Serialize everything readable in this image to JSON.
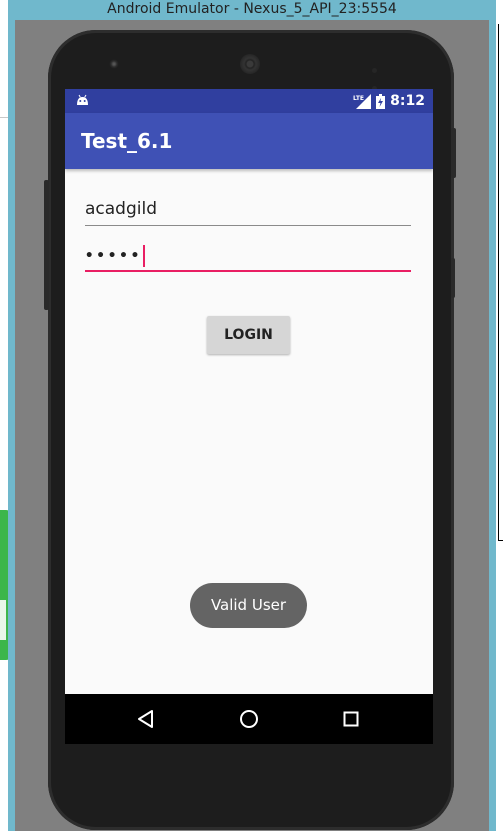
{
  "window": {
    "title": "Android Emulator - Nexus_5_API_23:5554"
  },
  "status_bar": {
    "time": "8:12",
    "network_label": "LTE"
  },
  "app_bar": {
    "title": "Test_6.1"
  },
  "form": {
    "username_value": "acadgild",
    "password_masked": "•••••",
    "login_label": "LOGIN"
  },
  "toast": {
    "message": "Valid User"
  },
  "colors": {
    "status_bar": "#303f9f",
    "app_bar": "#3f51b5",
    "accent": "#e91e63",
    "toast_bg": "#646464"
  },
  "icons": {
    "status": [
      "android-icon",
      "lte-signal-icon",
      "battery-charging-icon"
    ],
    "navigation": [
      "back-icon",
      "home-icon",
      "recents-icon"
    ]
  }
}
